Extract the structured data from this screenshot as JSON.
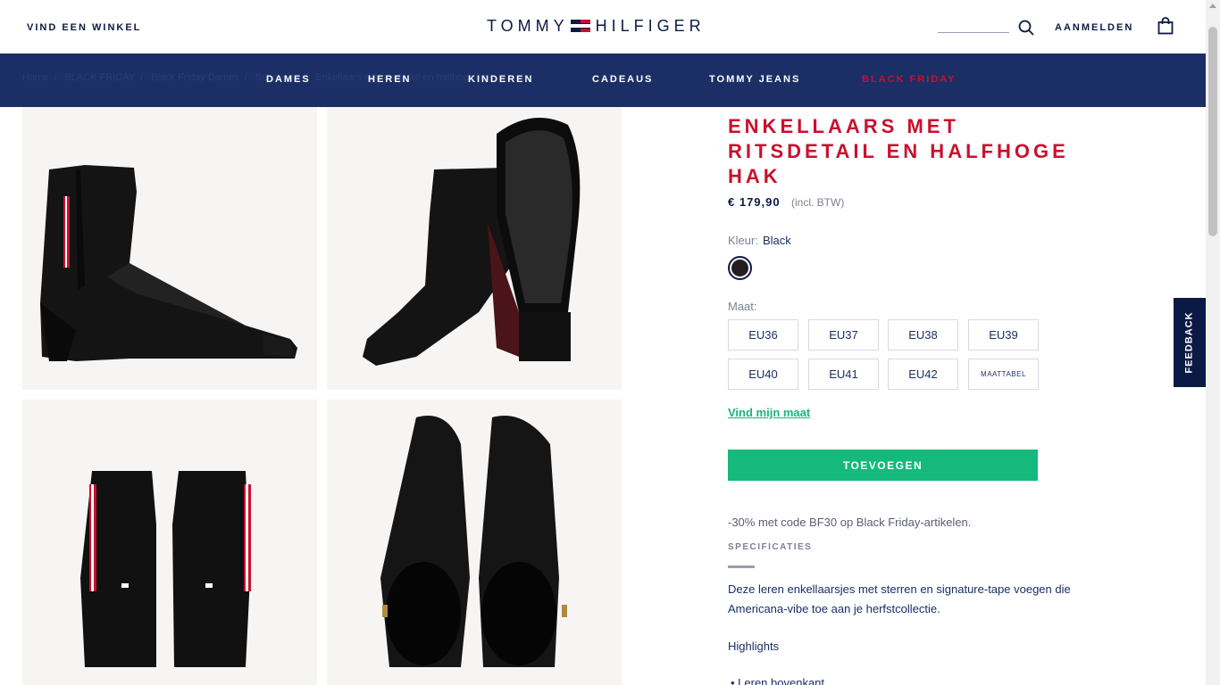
{
  "header": {
    "store_link": "VIND EEN WINKEL",
    "logo_left": "TOMMY",
    "logo_right": "HILFIGER",
    "login": "AANMELDEN"
  },
  "nav": {
    "items": [
      "DAMES",
      "HEREN",
      "KINDEREN",
      "CADEAUS",
      "TOMMY JEANS",
      "BLACK FRIDAY"
    ]
  },
  "breadcrumb": [
    "Home",
    "BLACK FRIDAY",
    "Black Friday Dames",
    "Schoenen",
    "Enkellaars met ritsdetail en halfhoge hak"
  ],
  "product": {
    "brand": "TOMMY HILFIGER",
    "title": "ENKELLAARS MET RITSDETAIL EN HALFHOGE HAK",
    "price": "€ 179,90",
    "price_note": "(incl. BTW)",
    "color_label": "Kleur:",
    "color_value": "Black",
    "size_label": "Maat:",
    "sizes": [
      "EU36",
      "EU37",
      "EU38",
      "EU39",
      "EU40",
      "EU41",
      "EU42"
    ],
    "size_table": "MAATTABEL",
    "find_size": "Vind mijn maat",
    "add_button": "TOEVOEGEN",
    "promo": "-30% met code BF30 op Black Friday-artikelen.",
    "spec_title": "SPECIFICATIES",
    "description": "Deze leren enkellaarsjes met sterren en signature-tape voegen die Americana-vibe toe aan je herfstcollectie.",
    "highlights": "Highlights",
    "bullet": "• Leren bovenkant"
  },
  "feedback": "FEEDBACK",
  "colors": {
    "navy": "#1b2f66",
    "red": "#c8102e",
    "green": "#16b97c"
  }
}
